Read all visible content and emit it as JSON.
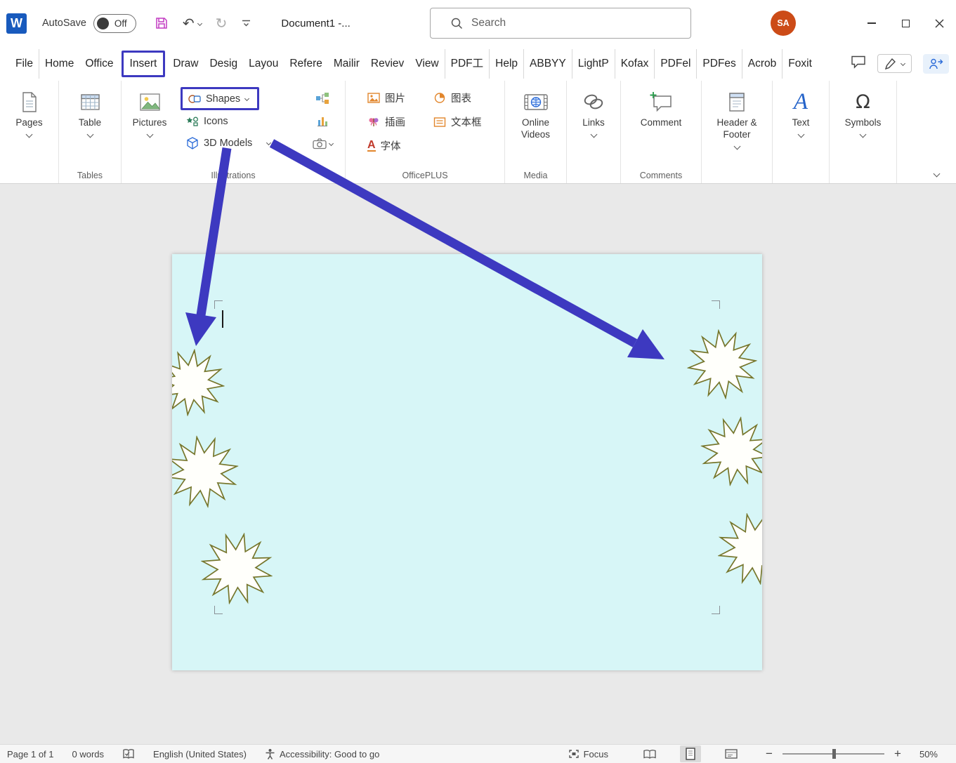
{
  "window": {
    "autosave_label": "AutoSave",
    "autosave_state": "Off",
    "doc_title": "Document1  -...",
    "search_placeholder": "Search",
    "avatar_initials": "SA"
  },
  "tabs": [
    "File",
    "Home",
    "Office",
    "Insert",
    "Draw",
    "Desig",
    "Layou",
    "Refere",
    "Mailir",
    "Reviev",
    "View",
    "PDF工",
    "Help",
    "ABBYY",
    "LightP",
    "Kofax",
    "PDFel",
    "PDFes",
    "Acrob",
    "Foxit"
  ],
  "ribbon": {
    "pages_label": "Pages",
    "table_label": "Table",
    "tables_group": "Tables",
    "pictures_label": "Pictures",
    "shapes_label": "Shapes",
    "icons_label": "Icons",
    "models_label": "3D Models",
    "illustrations_group": "Illustrations",
    "cn_picture": "图片",
    "cn_chart": "图表",
    "cn_illustration": "插画",
    "cn_textbox": "文本框",
    "cn_font": "字体",
    "officeplus_group": "OfficePLUS",
    "online_videos_label": "Online Videos",
    "media_group": "Media",
    "links_label": "Links",
    "comment_label": "Comment",
    "comments_group": "Comments",
    "header_footer_label": "Header & Footer",
    "text_label": "Text",
    "symbols_label": "Symbols"
  },
  "statusbar": {
    "page_info": "Page 1 of 1",
    "word_count": "0 words",
    "language": "English (United States)",
    "accessibility": "Accessibility: Good to go",
    "focus_label": "Focus",
    "zoom_value": "50%"
  },
  "colors": {
    "annotation_blue": "#3d39c0",
    "star_outline": "#76762c",
    "page_background": "#d7f6f7",
    "avatar_background": "#cc4b17"
  }
}
